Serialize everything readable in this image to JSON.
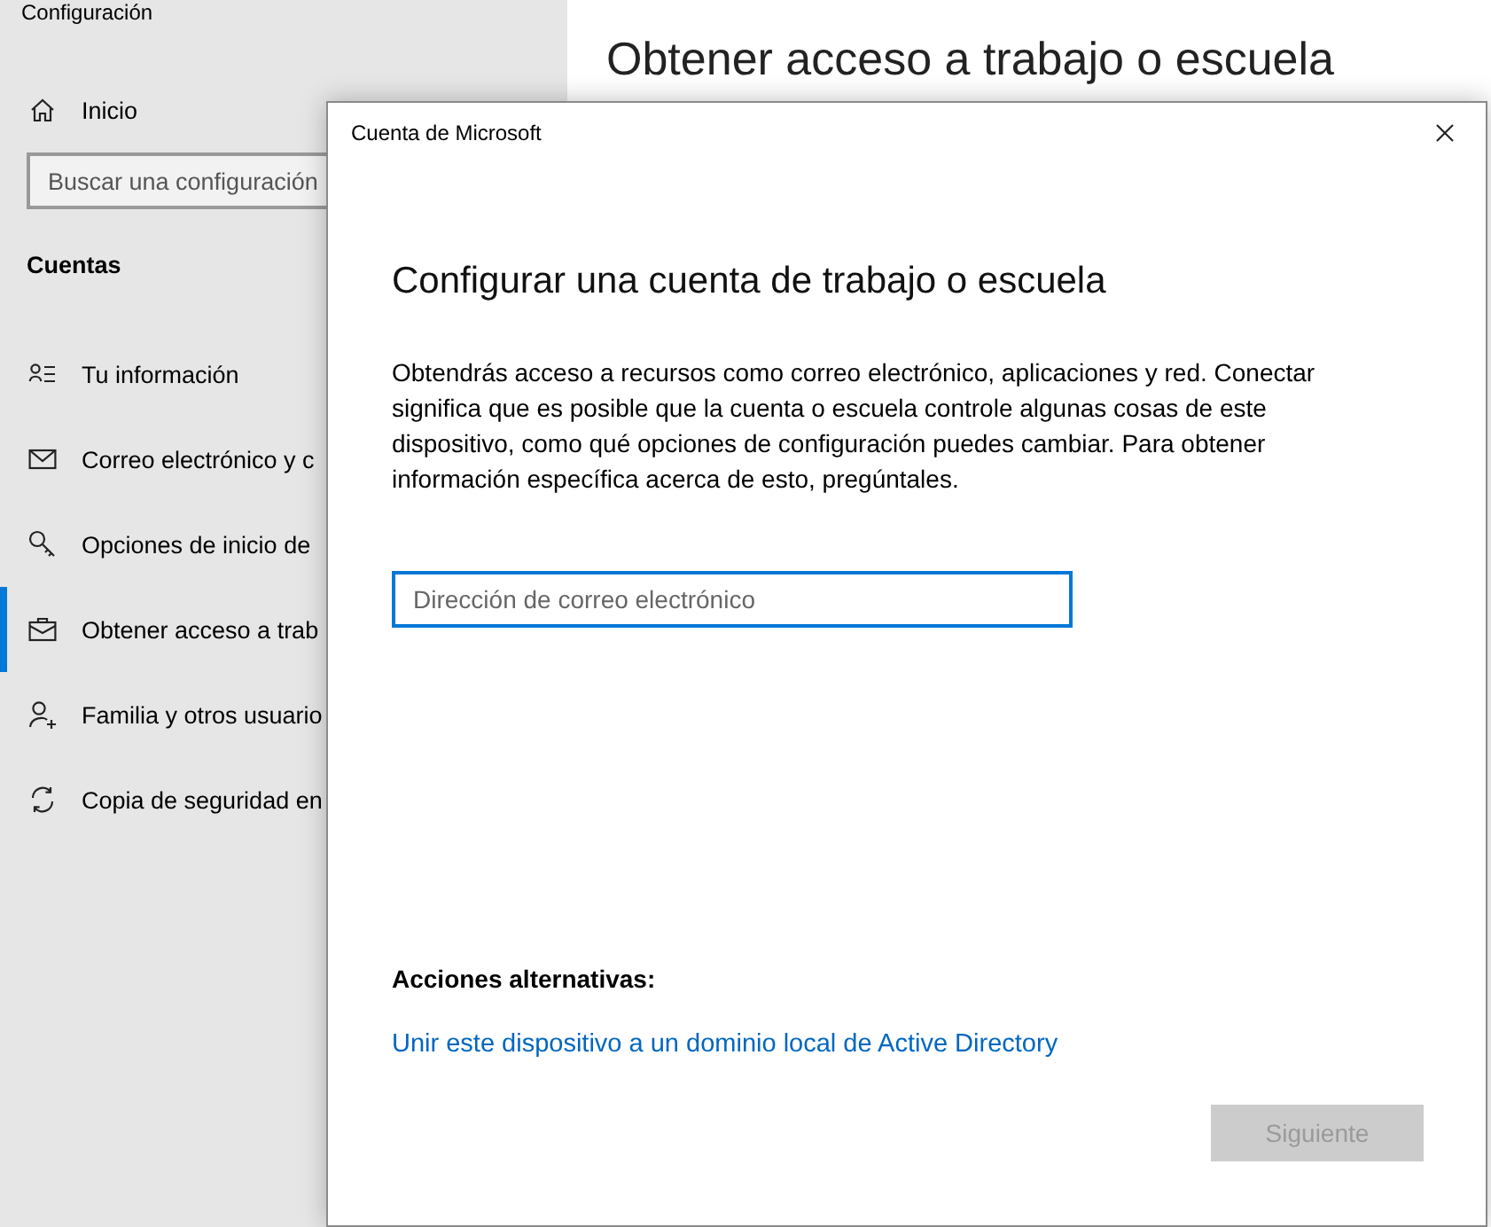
{
  "window": {
    "title": "Configuración"
  },
  "sidebar": {
    "home": "Inicio",
    "search": {
      "placeholder": "Buscar una configuración"
    },
    "section": "Cuentas",
    "items": [
      {
        "label": "Tu información",
        "selected": false
      },
      {
        "label": "Correo electrónico y c",
        "selected": false
      },
      {
        "label": "Opciones de inicio de",
        "selected": false
      },
      {
        "label": "Obtener acceso a trab",
        "selected": true
      },
      {
        "label": "Familia y otros usuario",
        "selected": false
      },
      {
        "label": "Copia de seguridad en",
        "selected": false
      }
    ]
  },
  "page_heading": "Obtener acceso a trabajo o escuela",
  "dialog": {
    "title": "Cuenta de Microsoft",
    "heading": "Configurar una cuenta de trabajo o escuela",
    "description": "Obtendrás acceso a recursos como correo electrónico, aplicaciones y red. Conectar significa que es posible que la cuenta o escuela controle algunas cosas de este dispositivo, como qué opciones de configuración puedes cambiar. Para obtener información específica acerca de esto, pregúntales.",
    "email": {
      "placeholder": "Dirección de correo electrónico"
    },
    "alt_heading": "Acciones alternativas:",
    "alt_link": "Unir este dispositivo a un dominio local de Active Directory",
    "next_button": {
      "label": "Siguiente",
      "disabled": true
    }
  }
}
